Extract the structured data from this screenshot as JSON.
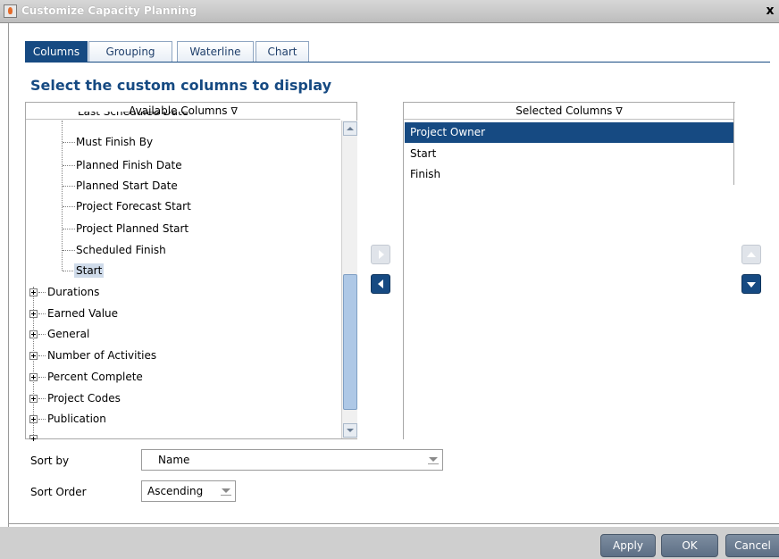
{
  "window": {
    "title": "Customize Capacity Planning",
    "close_glyph": "x",
    "app_icon": "java-icon"
  },
  "tabs": [
    {
      "label": "Columns",
      "active": true
    },
    {
      "label": "Grouping",
      "active": false
    },
    {
      "label": "Waterline",
      "active": false
    },
    {
      "label": "Chart",
      "active": false
    }
  ],
  "heading": "Select the custom columns to display",
  "available": {
    "header": "Available Columns",
    "filter_icon": "∇",
    "partial_top_item": "Last Scheduled Date",
    "child_items": [
      "Must Finish By",
      "Planned Finish Date",
      "Planned Start Date",
      "Project Forecast Start",
      "Project Planned Start",
      "Scheduled Finish",
      "Start"
    ],
    "selected_child": "Start",
    "groups": [
      "Durations",
      "Earned Value",
      "General",
      "Number of Activities",
      "Percent Complete",
      "Project Codes",
      "Publication"
    ]
  },
  "selected": {
    "header": "Selected Columns",
    "filter_icon": "∇",
    "items": [
      "Project Owner",
      "Start",
      "Finish"
    ],
    "active_item": "Project Owner"
  },
  "sort": {
    "sort_by_label": "Sort by",
    "sort_by_value": "Name",
    "sort_order_label": "Sort Order",
    "sort_order_value": "Ascending"
  },
  "buttons": {
    "apply": "Apply",
    "ok": "OK",
    "cancel": "Cancel"
  },
  "colors": {
    "accent": "#164a82",
    "selection_light": "#cfdbea",
    "footer_button": "#6b7c91"
  }
}
